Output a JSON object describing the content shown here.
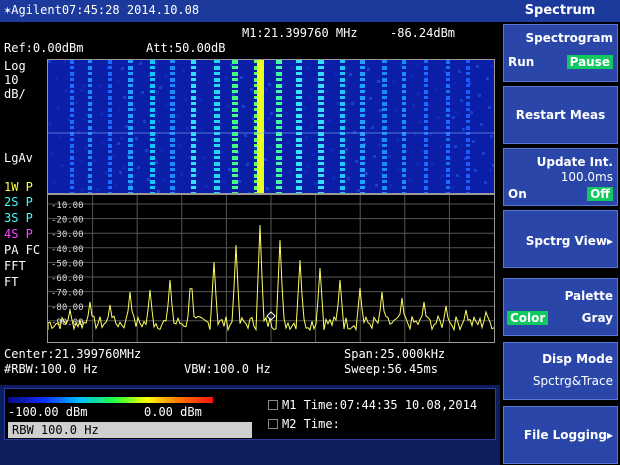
{
  "header": {
    "logo_glyph": "✶",
    "brand": "Agilent",
    "time": "07:45:28",
    "date": "2014.10.08",
    "panel_title": "Spectrum"
  },
  "marker": {
    "readout": "M1:21.399760 MHz",
    "level": "-86.24dBm"
  },
  "settings": {
    "ref": "Ref:0.00dBm",
    "att": "Att:50.00dB",
    "scale1": "Log",
    "scale2": "10",
    "scale3": "dB/",
    "avg": "LgAv",
    "traces": [
      {
        "label": "1W P",
        "color": "#ffff40"
      },
      {
        "label": "2S P",
        "color": "#40ffff"
      },
      {
        "label": "3S P",
        "color": "#40ffff"
      },
      {
        "label": "4S P",
        "color": "#ff40ff"
      }
    ],
    "pa": "PA FC",
    "fft": "FFT",
    "ft": "FT"
  },
  "y_ticks": [
    "-10.00",
    "-20.00",
    "-30.00",
    "-40.00",
    "-50.00",
    "-60.00",
    "-70.00",
    "-80.00",
    "-90.00"
  ],
  "footer": {
    "center": "Center:21.399760MHz",
    "span": "Span:25.000kHz",
    "rbw": "#RBW:100.0 Hz",
    "vbw": "VBW:100.0 Hz",
    "sweep": "Sweep:56.45ms"
  },
  "colorbar": {
    "min": "-100.00 dBm",
    "max": "0.00 dBm"
  },
  "rbw_box": "RBW  100.0  Hz",
  "markers_time": {
    "m1": "M1 Time:07:44:35 10.08,2014",
    "m2": "M2 Time:"
  },
  "softkeys": {
    "spectrogram": {
      "title": "Spectrogram",
      "left": "Run",
      "right": "Pause"
    },
    "restart": "Restart Meas",
    "update": {
      "title": "Update Int.",
      "value": "100.0ms",
      "left": "On",
      "right": "Off"
    },
    "spctrg_view": "Spctrg View▸",
    "palette": {
      "title": "Palette",
      "left": "Color",
      "right": "Gray"
    },
    "disp_mode": {
      "title": "Disp Mode",
      "value": "Spctrg&Trace"
    },
    "file_logging": "File Logging▸"
  }
}
